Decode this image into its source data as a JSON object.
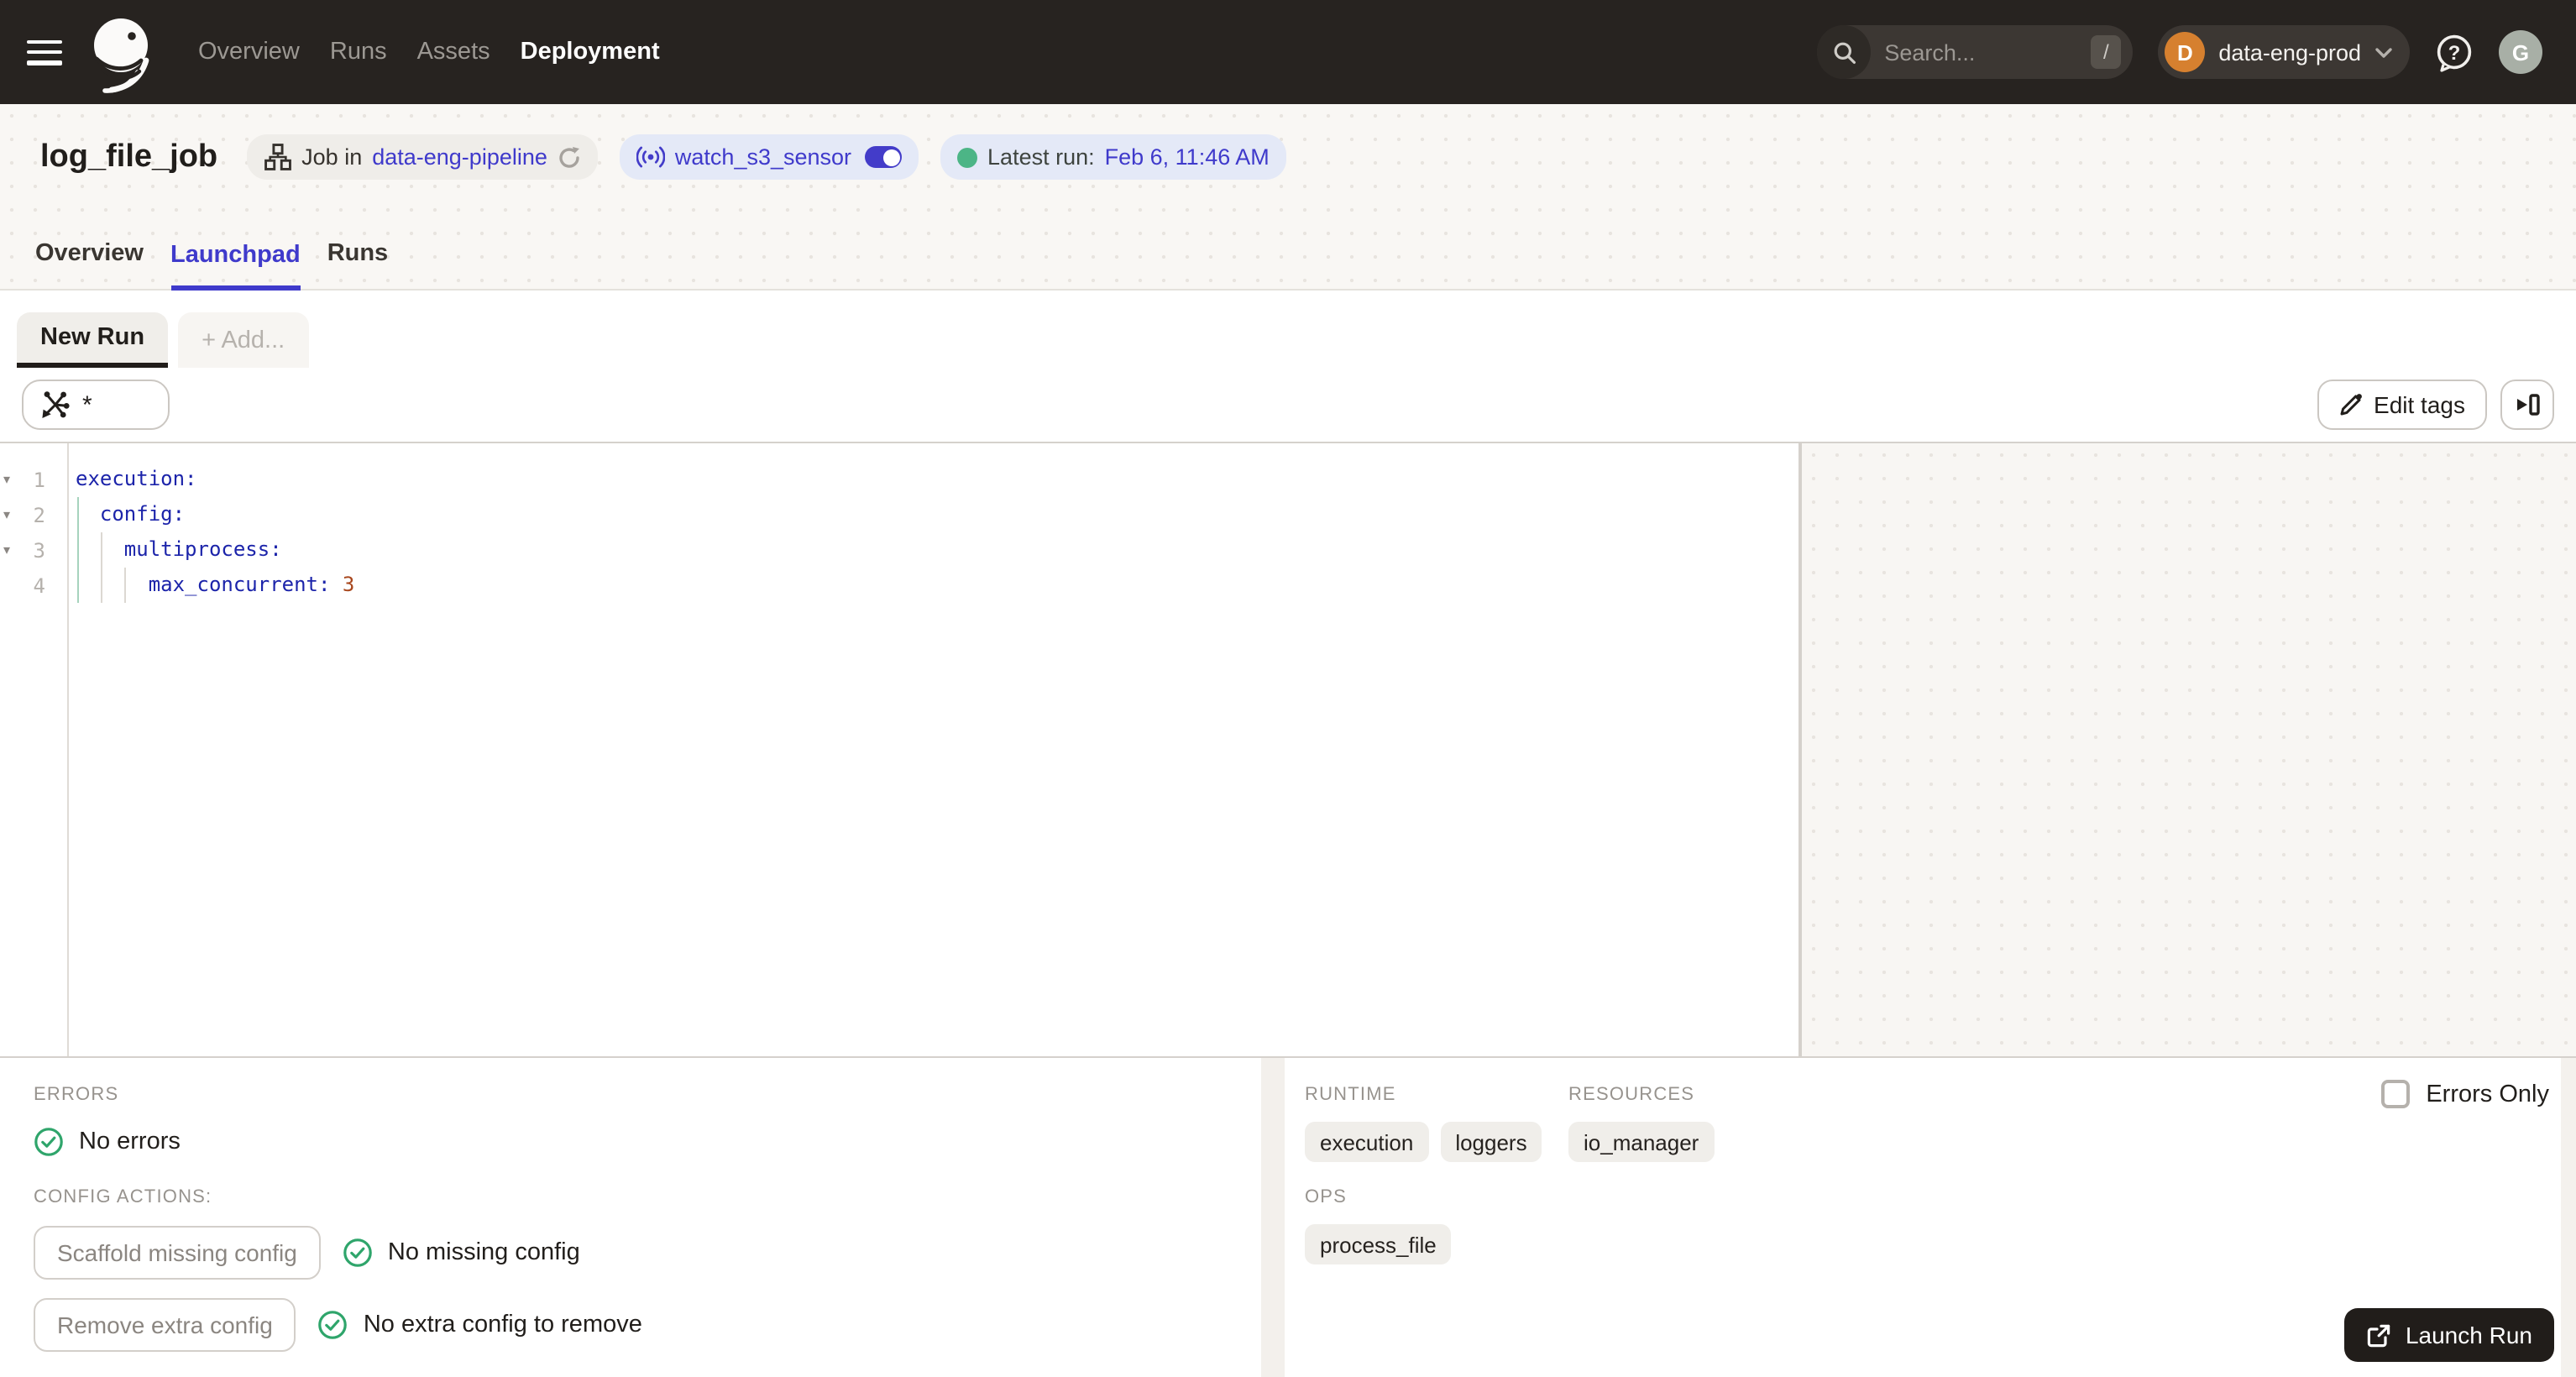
{
  "colors": {
    "accent_indigo": "#3f3acb",
    "success_green": "#2fa56b",
    "workspace_orange": "#d6802f",
    "nav_dark": "#272320"
  },
  "nav": {
    "items": [
      "Overview",
      "Runs",
      "Assets",
      "Deployment"
    ],
    "active_item": "Deployment",
    "search_placeholder": "Search...",
    "search_shortcut": "/",
    "workspace_initial": "D",
    "workspace_name": "data-eng-prod",
    "avatar_initial": "G"
  },
  "header": {
    "title": "log_file_job",
    "job_prefix": "Job in",
    "job_link": "data-eng-pipeline",
    "sensor_name": "watch_s3_sensor",
    "latest_run_label": "Latest run:",
    "latest_run_value": "Feb 6, 11:46 AM"
  },
  "tabs": [
    {
      "label": "Overview"
    },
    {
      "label": "Launchpad",
      "active": true
    },
    {
      "label": "Runs"
    }
  ],
  "session": {
    "active_tab": "New Run",
    "add_tab": "+ Add..."
  },
  "toolbar": {
    "op_selection": "*",
    "edit_tags": "Edit tags"
  },
  "editor": {
    "fold_glyph": "▾",
    "lines": [
      {
        "n": "1",
        "code": "execution:"
      },
      {
        "n": "2",
        "code": "  config:"
      },
      {
        "n": "3",
        "code": "    multiprocess:"
      },
      {
        "n": "4",
        "code": "      max_concurrent: ",
        "value": "3"
      }
    ]
  },
  "checks": {
    "errors_label": "ERRORS",
    "no_errors": "No errors",
    "config_actions_label": "CONFIG ACTIONS:",
    "scaffold_button": "Scaffold missing config",
    "scaffold_status": "No missing config",
    "remove_button": "Remove extra config",
    "remove_status": "No extra config to remove"
  },
  "summary": {
    "runtime_label": "RUNTIME",
    "runtime_tags": [
      "execution",
      "loggers"
    ],
    "resources_label": "RESOURCES",
    "resources_tags": [
      "io_manager"
    ],
    "ops_label": "OPS",
    "ops_tags": [
      "process_file"
    ],
    "errors_only_label": "Errors Only"
  },
  "launch": {
    "label": "Launch Run"
  }
}
